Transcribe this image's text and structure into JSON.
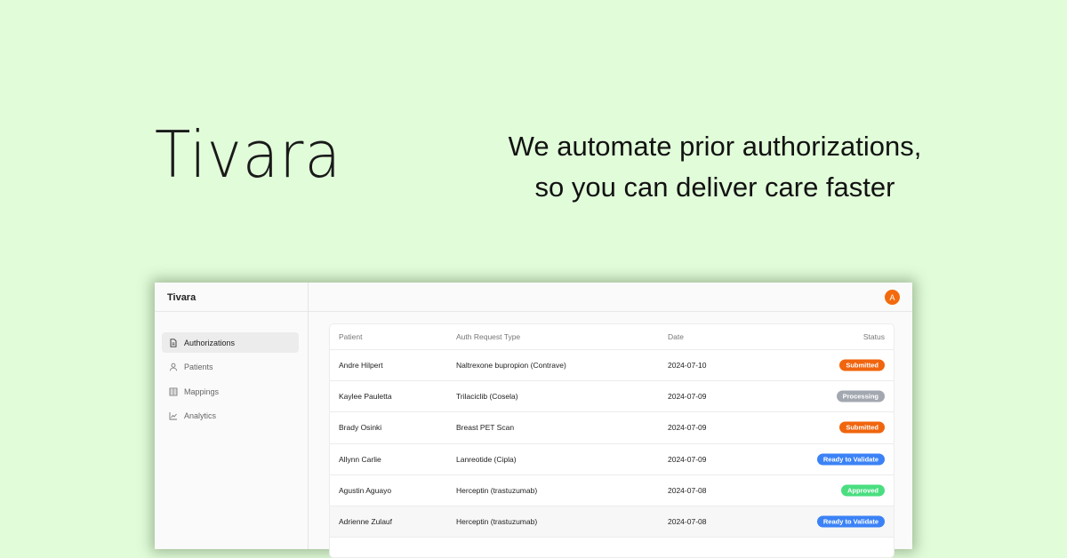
{
  "hero": {
    "brand": "Tivara",
    "tagline_line1": "We automate prior authorizations,",
    "tagline_line2": "so you can deliver care faster"
  },
  "app": {
    "title": "Tivara",
    "avatar_initial": "A",
    "sidebar": {
      "items": [
        {
          "label": "Authorizations",
          "icon": "document-icon",
          "active": true
        },
        {
          "label": "Patients",
          "icon": "user-icon",
          "active": false
        },
        {
          "label": "Mappings",
          "icon": "grid-icon",
          "active": false
        },
        {
          "label": "Analytics",
          "icon": "chart-icon",
          "active": false
        }
      ]
    },
    "table": {
      "headers": {
        "patient": "Patient",
        "auth": "Auth Request Type",
        "date": "Date",
        "status": "Status"
      },
      "rows": [
        {
          "patient": "Andre Hilpert",
          "auth": "Naltrexone bupropion (Contrave)",
          "date": "2024-07-10",
          "status": "Submitted"
        },
        {
          "patient": "Kaylee Pauletta",
          "auth": "Trilaciclib (Cosela)",
          "date": "2024-07-09",
          "status": "Processing"
        },
        {
          "patient": "Brady Osinki",
          "auth": "Breast PET Scan",
          "date": "2024-07-09",
          "status": "Submitted"
        },
        {
          "patient": "Allynn Carlie",
          "auth": "Lanreotide (Cipla)",
          "date": "2024-07-09",
          "status": "Ready to Validate"
        },
        {
          "patient": "Agustin Aguayo",
          "auth": "Herceptin (trastuzumab)",
          "date": "2024-07-08",
          "status": "Approved"
        },
        {
          "patient": "Adrienne Zulauf",
          "auth": "Herceptin (trastuzumab)",
          "date": "2024-07-08",
          "status": "Ready to Validate"
        }
      ]
    },
    "status_colors": {
      "Submitted": "#f0650e",
      "Processing": "#a3a8b0",
      "Ready to Validate": "#3b82f6",
      "Approved": "#4ade80"
    },
    "accent": "#f26a0d",
    "background": "#e1fcd9"
  }
}
